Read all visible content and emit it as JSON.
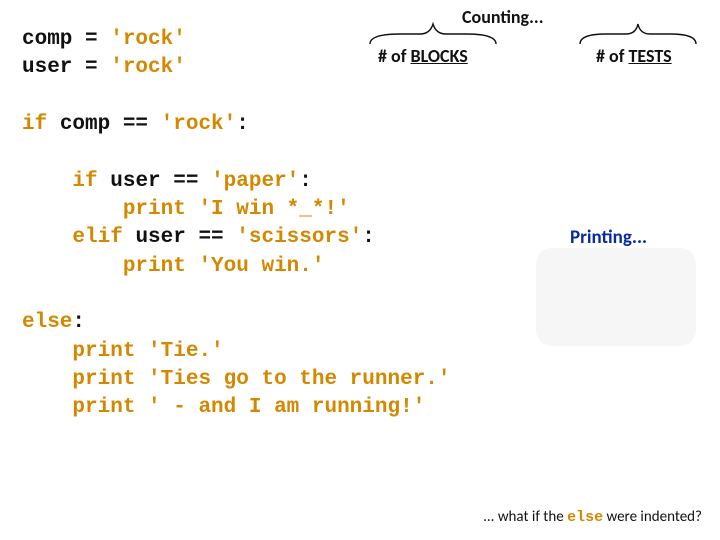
{
  "header": {
    "counting": "Counting...",
    "blocks_prefix": "# of ",
    "blocks_word": "BLOCKS",
    "tests_prefix": "# of ",
    "tests_word": "TESTS"
  },
  "labels": {
    "printing": "Printing..."
  },
  "code": {
    "l1a": "comp = ",
    "l1b": "'rock'",
    "l2a": "user = ",
    "l2b": "'rock'",
    "l3a": "if",
    "l3b": " comp == ",
    "l3c": "'rock'",
    "l3d": ":",
    "l4a": "if",
    "l4b": " user == ",
    "l4c": "'paper'",
    "l4d": ":",
    "l5a": "print",
    "l5b": " ",
    "l5c": "'I win *_*!'",
    "l6a": "elif",
    "l6b": " user == ",
    "l6c": "'scissors'",
    "l6d": ":",
    "l7a": "print",
    "l7b": " ",
    "l7c": "'You win.'",
    "l8a": "else",
    "l8b": ":",
    "l9a": "print",
    "l9b": " ",
    "l9c": "'Tie.'",
    "l10a": "print",
    "l10b": " ",
    "l10c": "'Ties go to the runner.'",
    "l11a": "print",
    "l11b": " ",
    "l11c": "' - and I am running!'"
  },
  "footer": {
    "prefix": "... what if the ",
    "kw": "else",
    "suffix": " were indented?"
  }
}
